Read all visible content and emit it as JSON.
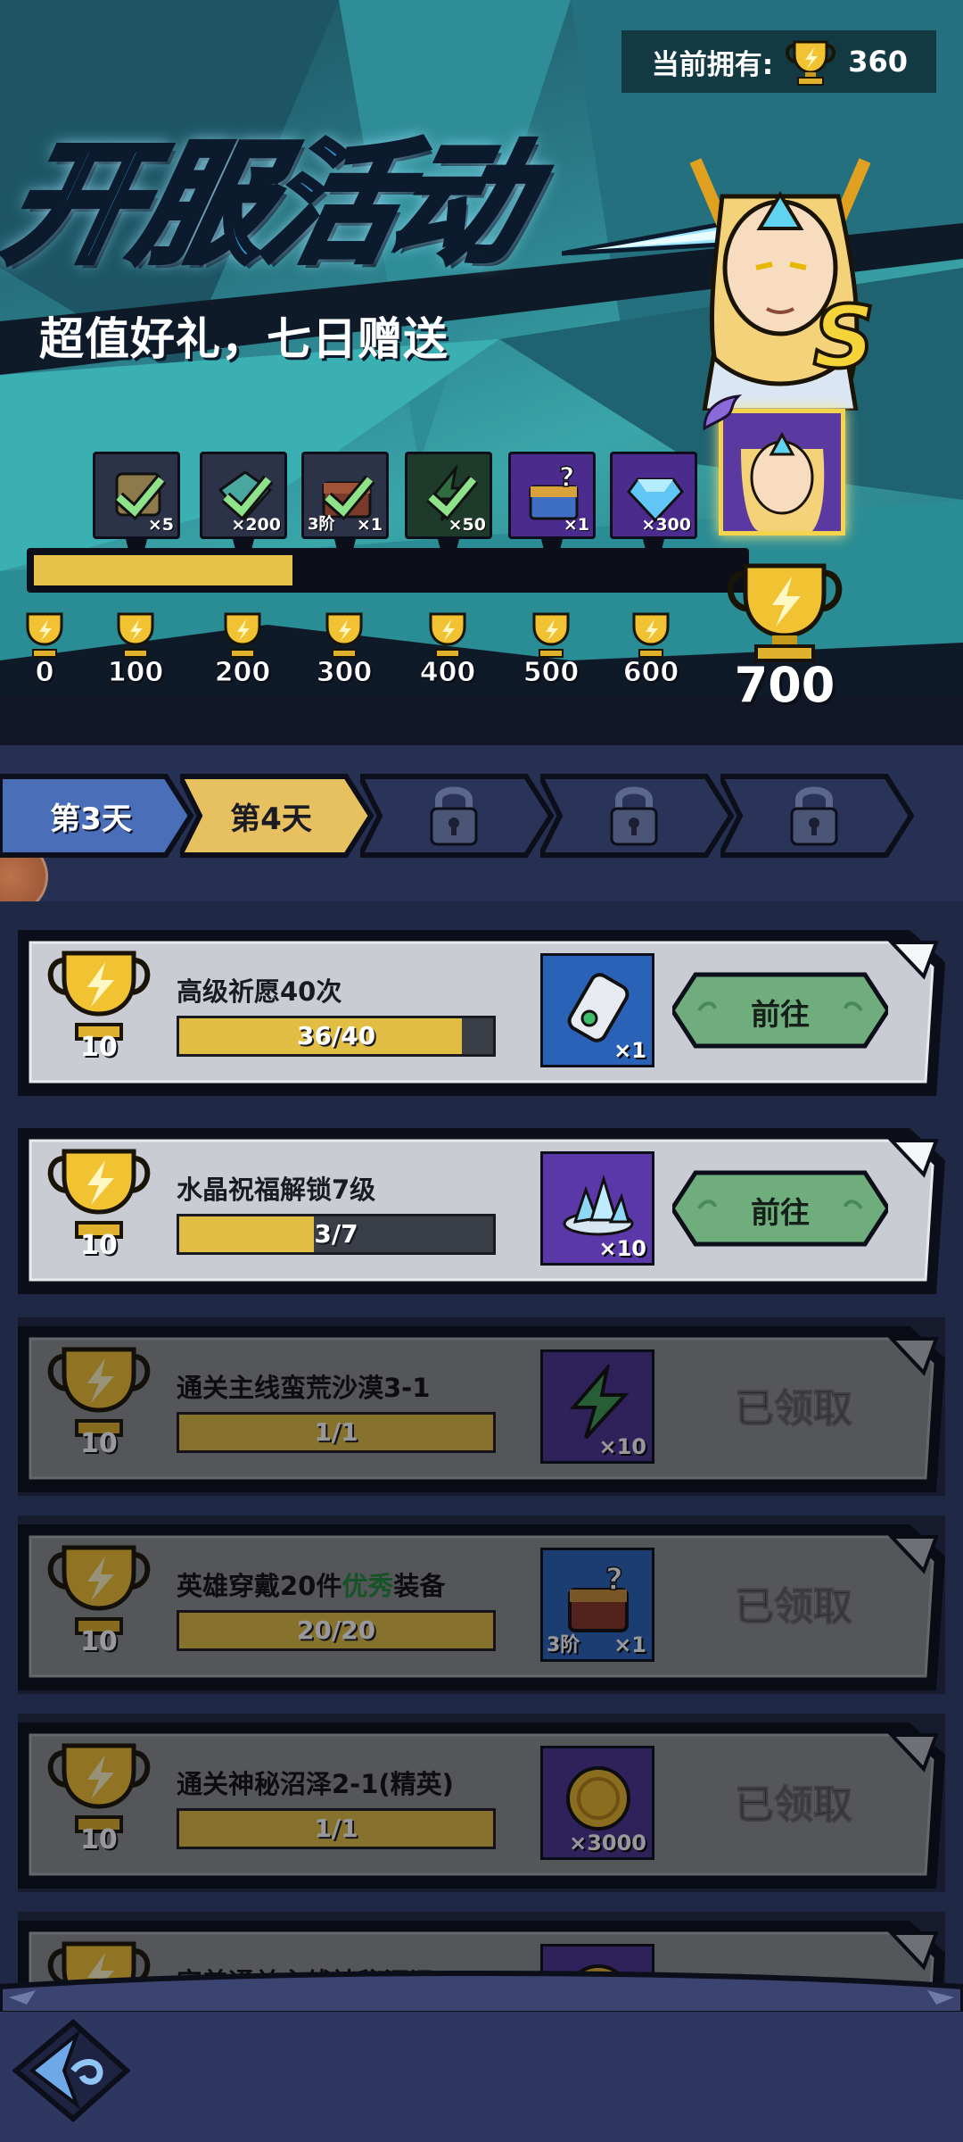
{
  "header": {
    "owned_label": "当前拥有:",
    "owned_value": "360",
    "title": "开服活动",
    "subtitle": "超值好礼，七日赠送",
    "hero_grade": "S"
  },
  "progress": {
    "current": 360,
    "max": 700,
    "rewards": [
      {
        "icon": "scroll-icon",
        "qty": "×5",
        "tier": "",
        "claimed": true,
        "color": "#2c3348"
      },
      {
        "icon": "gem-icon",
        "qty": "×200",
        "tier": "",
        "claimed": true,
        "color": "#2c3348"
      },
      {
        "icon": "chest-icon",
        "qty": "×1",
        "tier": "3阶",
        "claimed": true,
        "color": "#2c3348"
      },
      {
        "icon": "energy-icon",
        "qty": "×50",
        "tier": "",
        "claimed": true,
        "color": "#1d3a2b"
      },
      {
        "icon": "mystery-chest-icon",
        "qty": "×1",
        "tier": "",
        "claimed": false,
        "color": "#4b2c8e"
      },
      {
        "icon": "diamond-icon",
        "qty": "×300",
        "tier": "",
        "claimed": false,
        "color": "#4b2c8e"
      }
    ],
    "milestones": [
      "0",
      "100",
      "200",
      "300",
      "400",
      "500",
      "600"
    ],
    "final_milestone": "700"
  },
  "tabs": [
    {
      "label": "第3天",
      "state": "done"
    },
    {
      "label": "第4天",
      "state": "active"
    },
    {
      "label": "第5天",
      "state": "locked"
    },
    {
      "label": "第6天",
      "state": "locked"
    },
    {
      "label": "第7天",
      "state": "locked"
    }
  ],
  "tasks": [
    {
      "name": "高级祈愿40次",
      "name_prefix": "",
      "name_green": "",
      "name_suffix": "",
      "points": "10",
      "progress_text": "36/40",
      "progress_value": 0.9,
      "reward_icon": "wish-scroll-icon",
      "reward_qty": "×1",
      "reward_tier": "",
      "reward_bg": "#2a62b8",
      "action": "前往",
      "state": "open"
    },
    {
      "name": "水晶祝福解锁7级",
      "name_prefix": "",
      "name_green": "",
      "name_suffix": "",
      "points": "10",
      "progress_text": "3/7",
      "progress_value": 0.4286,
      "reward_icon": "crystal-icon",
      "reward_qty": "×10",
      "reward_tier": "",
      "reward_bg": "#5a38a8",
      "action": "前往",
      "state": "open"
    },
    {
      "name": "通关主线蛮荒沙漠3-1",
      "name_prefix": "",
      "name_green": "",
      "name_suffix": "",
      "points": "10",
      "progress_text": "1/1",
      "progress_value": 1,
      "reward_icon": "energy-icon",
      "reward_qty": "×10",
      "reward_tier": "",
      "reward_bg": "#4a3290",
      "action": "已领取",
      "state": "claimed"
    },
    {
      "name": "",
      "name_prefix": "英雄穿戴20件",
      "name_green": "优秀",
      "name_suffix": "装备",
      "points": "10",
      "progress_text": "20/20",
      "progress_value": 1,
      "reward_icon": "chest-icon",
      "reward_qty": "×1",
      "reward_tier": "3阶",
      "reward_bg": "#2a62b8",
      "action": "已领取",
      "state": "claimed"
    },
    {
      "name": "通关神秘沼泽2-1(精英)",
      "name_prefix": "",
      "name_green": "",
      "name_suffix": "",
      "points": "10",
      "progress_text": "1/1",
      "progress_value": 1,
      "reward_icon": "gold-coin-icon",
      "reward_qty": "×3000",
      "reward_tier": "",
      "reward_bg": "#4a3290",
      "action": "已领取",
      "state": "claimed"
    },
    {
      "name": "完美通关主线神秘沼泽2-7",
      "name_prefix": "",
      "name_green": "",
      "name_suffix": "",
      "points": "10",
      "progress_text": "",
      "progress_value": 1,
      "reward_icon": "gold-coin-icon",
      "reward_qty": "",
      "reward_tier": "",
      "reward_bg": "#4a3290",
      "action": "已领取",
      "state": "claimed"
    }
  ],
  "footer": {
    "back_icon": "back-arrow-icon"
  },
  "colors": {
    "gold": "#e8c248",
    "go_button": "#6fae7c",
    "card_open": "#c9ccd2",
    "card_claimed": "#8a8d92"
  }
}
